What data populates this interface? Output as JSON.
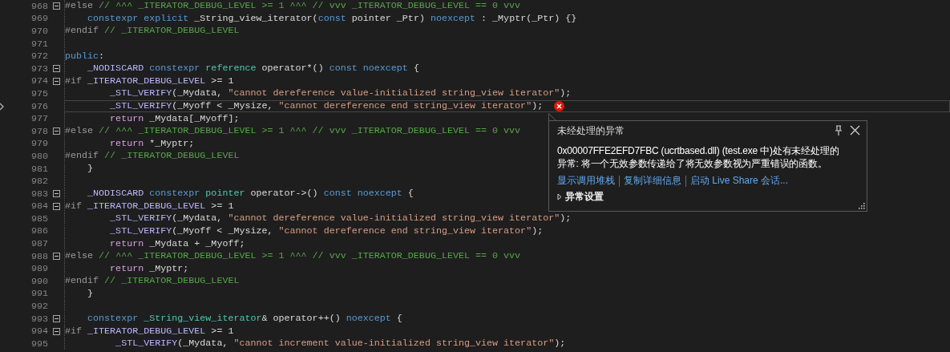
{
  "editor": {
    "lines": [
      {
        "number": "968",
        "fold": true,
        "tokens": [
          {
            "kind": "pp",
            "text": "#else"
          },
          {
            "kind": "cmt",
            "text": " // ^^^ _ITERATOR_DEBUG_LEVEL >= 1 ^^^ // vvv _ITERATOR_DEBUG_LEVEL == 0 vvv"
          }
        ]
      },
      {
        "number": "969",
        "fold": false,
        "tokens": [
          {
            "kind": "kw",
            "text": "    constexpr"
          },
          {
            "kind": "kw",
            "text": " explicit"
          },
          {
            "kind": "plain",
            "text": " _String_view_iterator("
          },
          {
            "kind": "kw",
            "text": "const"
          },
          {
            "kind": "plain",
            "text": " pointer _Ptr) "
          },
          {
            "kind": "kw",
            "text": "noexcept"
          },
          {
            "kind": "plain",
            "text": " : _Myptr(_Ptr) {}"
          }
        ]
      },
      {
        "number": "970",
        "fold": false,
        "tokens": [
          {
            "kind": "pp",
            "text": "#endif"
          },
          {
            "kind": "cmt",
            "text": " // _ITERATOR_DEBUG_LEVEL"
          }
        ]
      },
      {
        "number": "971",
        "fold": false
      },
      {
        "number": "972",
        "fold": false,
        "tokens": [
          {
            "kind": "kw",
            "text": "public"
          },
          {
            "kind": "plain",
            "text": ":"
          }
        ]
      },
      {
        "number": "973",
        "fold": true,
        "tokens": [
          {
            "kind": "macro",
            "text": "    _NODISCARD"
          },
          {
            "kind": "kw",
            "text": " constexpr"
          },
          {
            "kind": "type",
            "text": " reference"
          },
          {
            "kind": "plain",
            "text": " operator*() "
          },
          {
            "kind": "kw",
            "text": "const"
          },
          {
            "kind": "kw",
            "text": " noexcept"
          },
          {
            "kind": "plain",
            "text": " {"
          }
        ]
      },
      {
        "number": "974",
        "fold": true,
        "tokens": [
          {
            "kind": "pp",
            "text": "#if"
          },
          {
            "kind": "macro",
            "text": " _ITERATOR_DEBUG_LEVEL"
          },
          {
            "kind": "plain",
            "text": " >= 1"
          }
        ]
      },
      {
        "number": "975",
        "fold": false,
        "tokens": [
          {
            "kind": "macro",
            "text": "        _STL_VERIFY"
          },
          {
            "kind": "plain",
            "text": "(_Mydata, "
          },
          {
            "kind": "str",
            "text": "\"cannot dereference value-initialized string_view iterator\""
          },
          {
            "kind": "plain",
            "text": ");"
          }
        ]
      },
      {
        "number": "976",
        "fold": false,
        "current": true,
        "error": true,
        "tokens": [
          {
            "kind": "macro",
            "text": "        _STL_VERIFY"
          },
          {
            "kind": "plain",
            "text": "(_Myoff < _Mysize, "
          },
          {
            "kind": "str",
            "text": "\"cannot dereference end string_view iterator\""
          },
          {
            "kind": "plain",
            "text": ");"
          }
        ]
      },
      {
        "number": "977",
        "fold": false,
        "tokens": [
          {
            "kind": "ctl",
            "text": "        return"
          },
          {
            "kind": "plain",
            "text": " _Mydata[_Myoff];"
          }
        ]
      },
      {
        "number": "978",
        "fold": true,
        "tokens": [
          {
            "kind": "pp",
            "text": "#else"
          },
          {
            "kind": "cmt",
            "text": " // ^^^ _ITERATOR_DEBUG_LEVEL >= 1 ^^^ // vvv _ITERATOR_DEBUG_LEVEL == 0 vvv"
          }
        ]
      },
      {
        "number": "979",
        "fold": false,
        "tokens": [
          {
            "kind": "ctl",
            "text": "        return"
          },
          {
            "kind": "plain",
            "text": " *_Myptr;"
          }
        ]
      },
      {
        "number": "980",
        "fold": false,
        "tokens": [
          {
            "kind": "pp",
            "text": "#endif"
          },
          {
            "kind": "cmt",
            "text": " // _ITERATOR_DEBUG_LEVEL"
          }
        ]
      },
      {
        "number": "981",
        "fold": false,
        "tokens": [
          {
            "kind": "plain",
            "text": "    }"
          }
        ]
      },
      {
        "number": "982",
        "fold": false
      },
      {
        "number": "983",
        "fold": true,
        "tokens": [
          {
            "kind": "macro",
            "text": "    _NODISCARD"
          },
          {
            "kind": "kw",
            "text": " constexpr"
          },
          {
            "kind": "type",
            "text": " pointer"
          },
          {
            "kind": "plain",
            "text": " operator->() "
          },
          {
            "kind": "kw",
            "text": "const"
          },
          {
            "kind": "kw",
            "text": " noexcept"
          },
          {
            "kind": "plain",
            "text": " {"
          }
        ]
      },
      {
        "number": "984",
        "fold": true,
        "tokens": [
          {
            "kind": "pp",
            "text": "#if"
          },
          {
            "kind": "macro",
            "text": " _ITERATOR_DEBUG_LEVEL"
          },
          {
            "kind": "plain",
            "text": " >= 1"
          }
        ]
      },
      {
        "number": "985",
        "fold": false,
        "tokens": [
          {
            "kind": "macro",
            "text": "        _STL_VERIFY"
          },
          {
            "kind": "plain",
            "text": "(_Mydata, "
          },
          {
            "kind": "str",
            "text": "\"cannot dereference value-initialized string_view iterator\""
          },
          {
            "kind": "plain",
            "text": ");"
          }
        ]
      },
      {
        "number": "986",
        "fold": false,
        "tokens": [
          {
            "kind": "macro",
            "text": "        _STL_VERIFY"
          },
          {
            "kind": "plain",
            "text": "(_Myoff < _Mysize, "
          },
          {
            "kind": "str",
            "text": "\"cannot dereference end string_view iterator\""
          },
          {
            "kind": "plain",
            "text": ");"
          }
        ]
      },
      {
        "number": "987",
        "fold": false,
        "tokens": [
          {
            "kind": "ctl",
            "text": "        return"
          },
          {
            "kind": "plain",
            "text": " _Mydata + _Myoff;"
          }
        ]
      },
      {
        "number": "988",
        "fold": true,
        "tokens": [
          {
            "kind": "pp",
            "text": "#else"
          },
          {
            "kind": "cmt",
            "text": " // ^^^ _ITERATOR_DEBUG_LEVEL >= 1 ^^^ // vvv _ITERATOR_DEBUG_LEVEL == 0 vvv"
          }
        ]
      },
      {
        "number": "989",
        "fold": false,
        "tokens": [
          {
            "kind": "ctl",
            "text": "        return"
          },
          {
            "kind": "plain",
            "text": " _Myptr;"
          }
        ]
      },
      {
        "number": "990",
        "fold": false,
        "tokens": [
          {
            "kind": "pp",
            "text": "#endif"
          },
          {
            "kind": "cmt",
            "text": " // _ITERATOR_DEBUG_LEVEL"
          }
        ]
      },
      {
        "number": "991",
        "fold": false,
        "tokens": [
          {
            "kind": "plain",
            "text": "    }"
          }
        ]
      },
      {
        "number": "992",
        "fold": false
      },
      {
        "number": "993",
        "fold": true,
        "tokens": [
          {
            "kind": "kw",
            "text": "    constexpr"
          },
          {
            "kind": "type",
            "text": " _String_view_iterator"
          },
          {
            "kind": "plain",
            "text": "& operator++() "
          },
          {
            "kind": "kw",
            "text": "noexcept"
          },
          {
            "kind": "plain",
            "text": " {"
          }
        ]
      },
      {
        "number": "994",
        "fold": true,
        "tokens": [
          {
            "kind": "pp",
            "text": "#if"
          },
          {
            "kind": "macro",
            "text": " _ITERATOR_DEBUG_LEVEL"
          },
          {
            "kind": "plain",
            "text": " >= 1"
          }
        ]
      },
      {
        "number": "995",
        "fold": false,
        "tokens": [
          {
            "kind": "macro",
            "text": "         _STL_VERIFY"
          },
          {
            "kind": "plain",
            "text": "(_Mydata, "
          },
          {
            "kind": "str",
            "text": "\"cannot increment value-initialized string_view iterator\""
          },
          {
            "kind": "plain",
            "text": ");"
          }
        ]
      }
    ]
  },
  "exception_popup": {
    "title": "未经处理的异常",
    "message": "0x00007FFE2EFD7FBC (ucrtbased.dll) (test.exe 中)处有未经处理的异常: 将一个无效参数传递给了将无效参数视为严重错误的函数。",
    "links": [
      "显示调用堆栈",
      "复制详细信息",
      "启动 Live Share 会话..."
    ],
    "settings": {
      "label": "异常设置",
      "expanded": false
    }
  }
}
